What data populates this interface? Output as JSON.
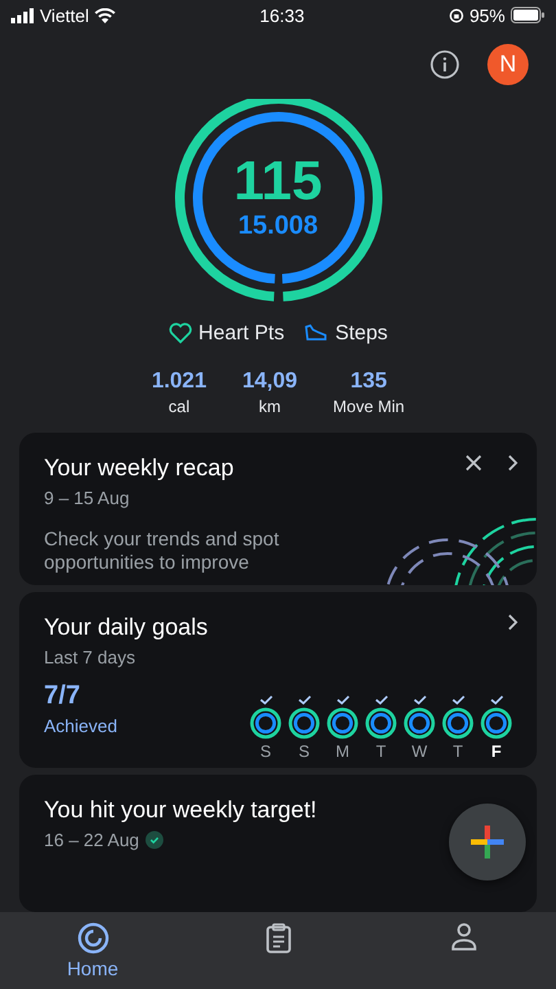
{
  "status_bar": {
    "carrier": "Viettel",
    "time": "16:33",
    "battery": "95%"
  },
  "header": {
    "avatar": "N"
  },
  "rings": {
    "heart_points": "115",
    "steps": "15.008",
    "outer": {
      "level": 0.985
    },
    "inner": {
      "level": 0.985
    }
  },
  "legend": [
    {
      "kind": "heart",
      "label": "Heart Pts"
    },
    {
      "kind": "steps",
      "label": "Steps"
    }
  ],
  "stats": [
    {
      "value": "1.021",
      "unit": "cal"
    },
    {
      "value": "14,09",
      "unit": "km"
    },
    {
      "value": "135",
      "unit": "Move Min"
    }
  ],
  "recap": {
    "title": "Your weekly recap",
    "dates": "9 – 15 Aug",
    "text": "Check your trends and spot opportunities to improve"
  },
  "goals": {
    "title": "Your daily goals",
    "subtitle": "Last 7 days",
    "count": "7/7",
    "status": "Achieved",
    "days": [
      {
        "label": "S",
        "achieved": true,
        "selected": false
      },
      {
        "label": "S",
        "achieved": true,
        "selected": false
      },
      {
        "label": "M",
        "achieved": true,
        "selected": false
      },
      {
        "label": "T",
        "achieved": true,
        "selected": false
      },
      {
        "label": "W",
        "achieved": true,
        "selected": false
      },
      {
        "label": "T",
        "achieved": true,
        "selected": false
      },
      {
        "label": "F",
        "achieved": true,
        "selected": true
      }
    ]
  },
  "target": {
    "title": "You hit your weekly target!",
    "dates": "16 – 22 Aug",
    "done": true
  },
  "nav": [
    {
      "kind": "home",
      "label": "Home",
      "selected": true
    },
    {
      "kind": "journal",
      "selected": false
    },
    {
      "kind": "profile",
      "selected": false
    }
  ]
}
